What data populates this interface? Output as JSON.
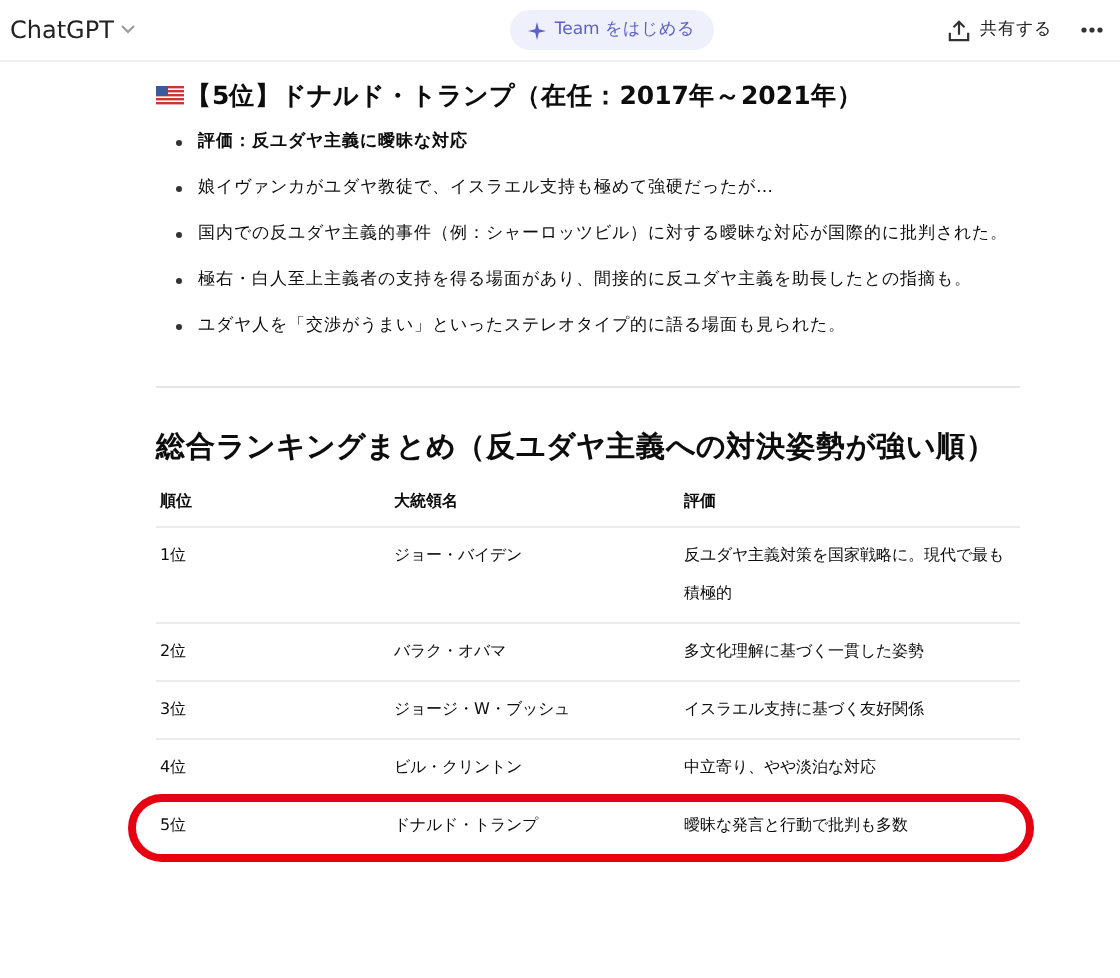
{
  "header": {
    "app_title": "ChatGPT",
    "promo_button": "Team をはじめる",
    "share_button": "共有する"
  },
  "section": {
    "heading": "【5位】ドナルド・トランプ（在任：2017年～2021年）",
    "bullets": [
      {
        "text": "評価：反ユダヤ主義に曖昧な対応",
        "bold": true
      },
      {
        "text": "娘イヴァンカがユダヤ教徒で、イスラエル支持も極めて強硬だったが…",
        "bold": false
      },
      {
        "text": "国内での反ユダヤ主義的事件（例：シャーロッツビル）に対する曖昧な対応が国際的に批判された。",
        "bold": false
      },
      {
        "text": "極右・白人至上主義者の支持を得る場面があり、間接的に反ユダヤ主義を助長したとの指摘も。",
        "bold": false
      },
      {
        "text": "ユダヤ人を「交渉がうまい」といったステレオタイプ的に語る場面も見られた。",
        "bold": false
      }
    ]
  },
  "summary": {
    "heading": "総合ランキングまとめ（反ユダヤ主義への対決姿勢が強い順）",
    "table": {
      "columns": [
        "順位",
        "大統領名",
        "評価"
      ],
      "rows": [
        {
          "cells": [
            "1位",
            "ジョー・バイデン",
            "反ユダヤ主義対策を国家戦略に。現代で最も積極的"
          ],
          "circled": false
        },
        {
          "cells": [
            "2位",
            "バラク・オバマ",
            "多文化理解に基づく一貫した姿勢"
          ],
          "circled": false
        },
        {
          "cells": [
            "3位",
            "ジョージ・W・ブッシュ",
            "イスラエル支持に基づく友好関係"
          ],
          "circled": false
        },
        {
          "cells": [
            "4位",
            "ビル・クリントン",
            "中立寄り、やや淡泊な対応"
          ],
          "circled": false
        },
        {
          "cells": [
            "5位",
            "ドナルド・トランプ",
            "曖昧な発言と行動で批判も多数"
          ],
          "circled": true
        }
      ]
    }
  }
}
